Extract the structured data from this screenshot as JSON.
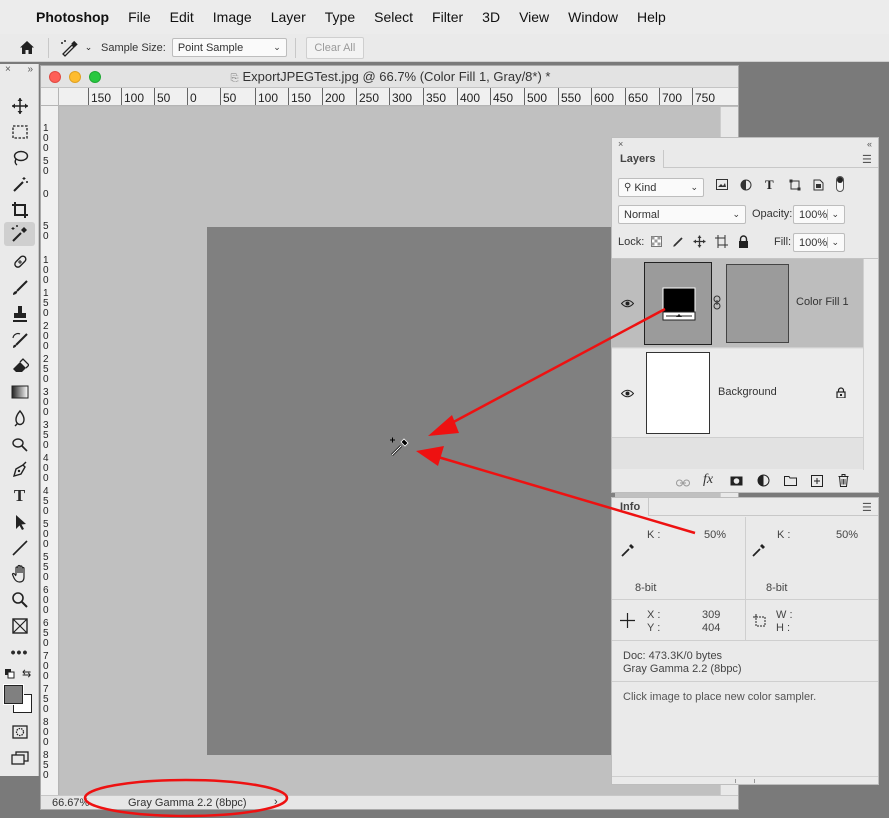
{
  "menubar": {
    "items": [
      "Photoshop",
      "File",
      "Edit",
      "Image",
      "Layer",
      "Type",
      "Select",
      "Filter",
      "3D",
      "View",
      "Window",
      "Help"
    ]
  },
  "options_bar": {
    "sample_size_label": "Sample Size:",
    "sample_size_value": "Point Sample",
    "clear_all_label": "Clear All"
  },
  "document": {
    "title": "ExportJPEGTest.jpg @ 66.7% (Color Fill 1, Gray/8*) *",
    "ruler_h": [
      "150",
      "100",
      "50",
      "0",
      "50",
      "100",
      "150",
      "200",
      "250",
      "300",
      "350",
      "400",
      "450",
      "500",
      "550",
      "600",
      "650",
      "700",
      "750"
    ],
    "ruler_v": [
      "1 0 0",
      "5 0",
      "0",
      "5 0",
      "1 0 0",
      "1 5 0",
      "2 0 0",
      "2 5 0",
      "3 0 0",
      "3 5 0",
      "4 0 0",
      "4 5 0",
      "5 0 0",
      "5 5 0",
      "6 0 0",
      "6 5 0",
      "7 0 0",
      "7 5 0",
      "8 0 0",
      "8 5 0"
    ],
    "zoom": "66.67%",
    "status": "Gray Gamma 2.2 (8bpc)"
  },
  "layers_panel": {
    "tab": "Layers",
    "filter_kind": "Kind",
    "blend_mode": "Normal",
    "opacity_label": "Opacity:",
    "opacity_value": "100%",
    "lock_label": "Lock:",
    "fill_label": "Fill:",
    "fill_value": "100%",
    "layers": [
      {
        "name": "Color Fill 1",
        "selected": true
      },
      {
        "name": "Background",
        "locked": true
      }
    ]
  },
  "info_panel": {
    "tab": "Info",
    "k_label_1": "K :",
    "k_value_1": "50%",
    "k_label_2": "K :",
    "k_value_2": "50%",
    "bit_1": "8-bit",
    "bit_2": "8-bit",
    "x_label": "X :",
    "x_value": "309",
    "y_label": "Y :",
    "y_value": "404",
    "w_label": "W :",
    "h_label": "H :",
    "doc_size": "Doc: 473.3K/0 bytes",
    "profile": "Gray Gamma 2.2 (8bpc)",
    "hint": "Click image to place new color sampler."
  },
  "colors": {
    "annotation_red": "#ee1111",
    "artboard_gray": "#808080",
    "pasteboard": "#c0c0c0",
    "light_red": "#fe5f57",
    "light_yellow": "#febc2e",
    "light_green": "#28c840"
  }
}
